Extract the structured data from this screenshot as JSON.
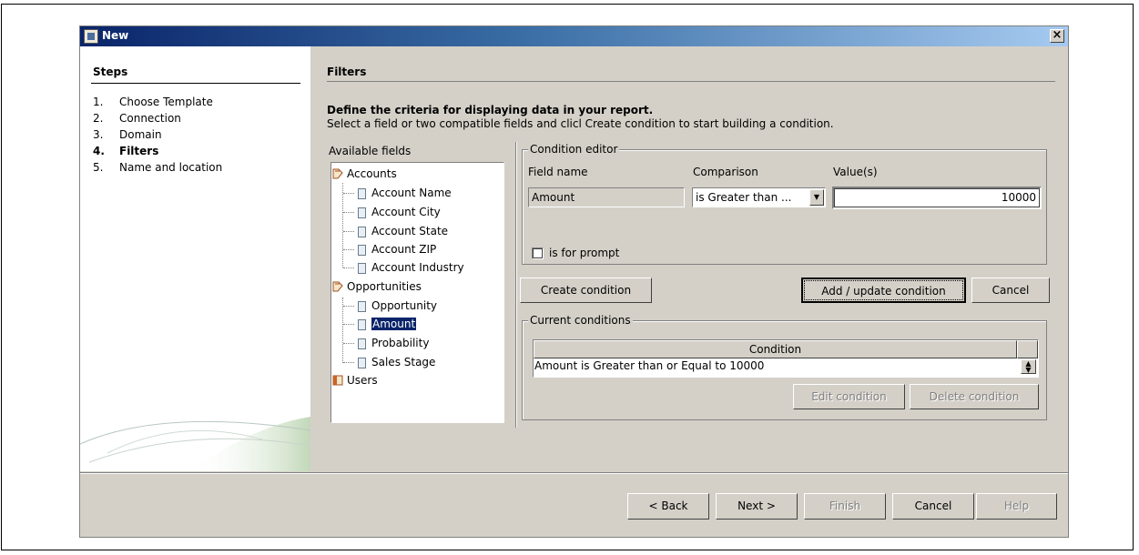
{
  "window": {
    "title": "New",
    "close_label": "×"
  },
  "steps": {
    "title": "Steps",
    "items": [
      {
        "num": "1.",
        "label": "Choose Template"
      },
      {
        "num": "2.",
        "label": "Connection"
      },
      {
        "num": "3.",
        "label": "Domain"
      },
      {
        "num": "4.",
        "label": "Filters"
      },
      {
        "num": "5.",
        "label": "Name and location"
      }
    ]
  },
  "main": {
    "title": "Filters",
    "heading": "Define the criteria for displaying data in your report.",
    "subheading": "Select a field or two compatible fields and clicl Create condition to start building a condition."
  },
  "fields": {
    "label": "Available fields",
    "tree": [
      {
        "label": "Accounts",
        "kind": "folder"
      },
      {
        "label": "Account Name",
        "kind": "field"
      },
      {
        "label": "Account City",
        "kind": "field"
      },
      {
        "label": "Account State",
        "kind": "field"
      },
      {
        "label": "Account ZIP",
        "kind": "field"
      },
      {
        "label": "Account Industry",
        "kind": "field"
      },
      {
        "label": "Opportunities",
        "kind": "folder"
      },
      {
        "label": "Opportunity",
        "kind": "field"
      },
      {
        "label": "Amount",
        "kind": "field"
      },
      {
        "label": "Probability",
        "kind": "field"
      },
      {
        "label": "Sales Stage",
        "kind": "field"
      },
      {
        "label": "Users",
        "kind": "folder"
      }
    ]
  },
  "editor": {
    "group_label": "Condition editor",
    "field_name_label": "Field name",
    "comparison_label": "Comparison",
    "values_label": "Value(s)",
    "field_name_value": "Amount",
    "comparison_value": "is Greater than ...",
    "value": "10000",
    "prompt_label": "is for prompt"
  },
  "buttons": {
    "create": "Create condition",
    "add_update": "Add / update condition",
    "cancel_condition": "Cancel",
    "edit": "Edit condition",
    "delete": "Delete condition",
    "back": "< Back",
    "next": "Next >",
    "finish": "Finish",
    "cancel": "Cancel",
    "help": "Help"
  },
  "conditions": {
    "group_label": "Current conditions",
    "column_header": "Condition",
    "rows": [
      "Amount is Greater than or Equal to 10000"
    ]
  },
  "colors": {
    "title_start": "#0a246a",
    "title_end": "#a6caf0",
    "selection": "#0a246a",
    "dialog_bg": "#d4d0c8"
  }
}
